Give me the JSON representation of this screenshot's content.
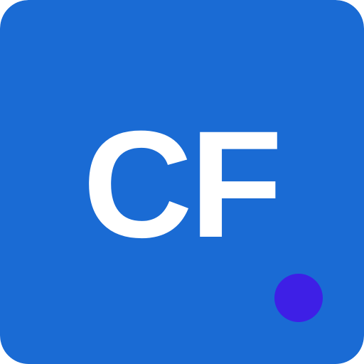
{
  "icon": {
    "monogram": "CF",
    "colors": {
      "background": "#1a6bd4",
      "text": "#ffffff",
      "badge": "#3e1fe6"
    },
    "badge_icon": "notification-dot-icon"
  }
}
